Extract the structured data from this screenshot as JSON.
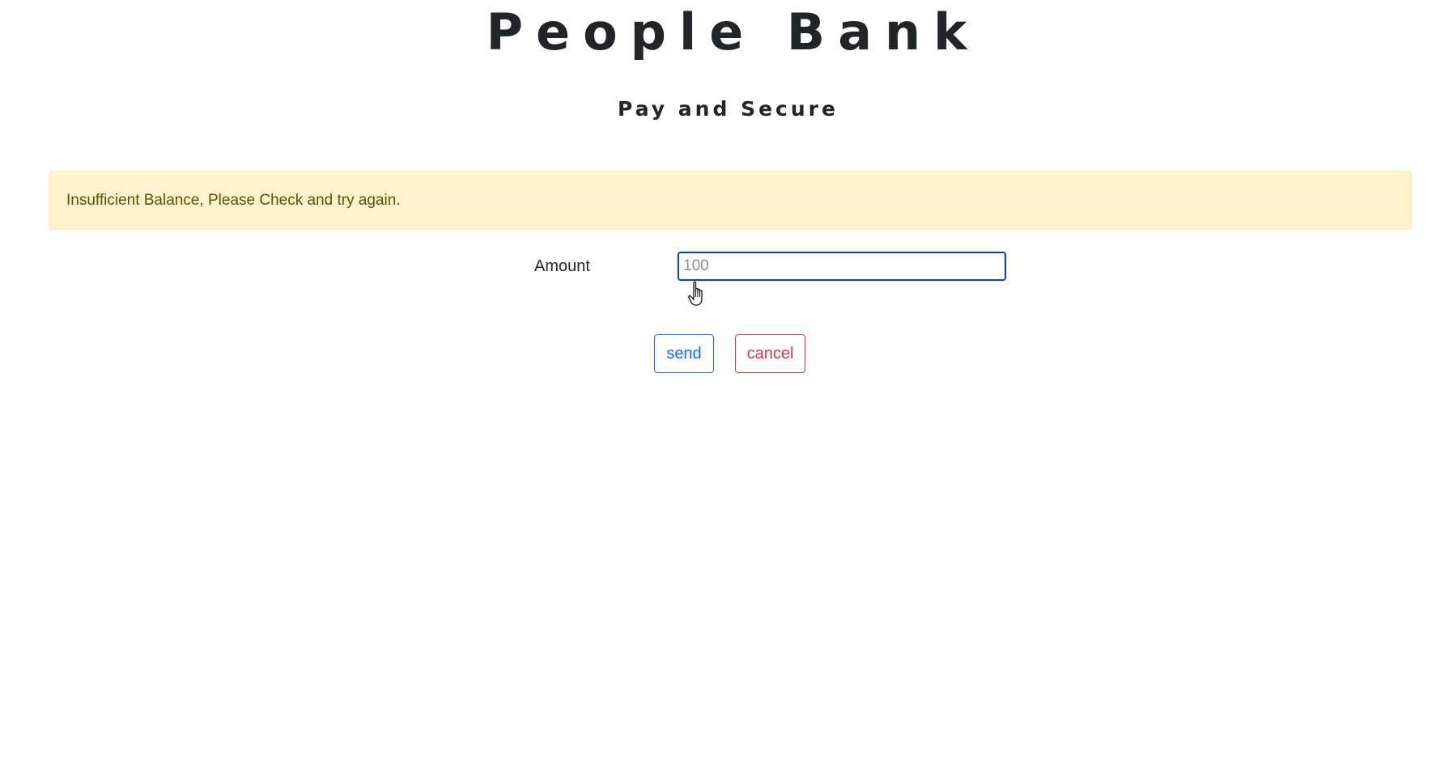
{
  "header": {
    "title": "People Bank",
    "tagline": "Pay and Secure"
  },
  "alert": {
    "message": "Insufficient Balance, Please Check and try again.",
    "background": "#fff3cd",
    "text_color": "#664d03"
  },
  "form": {
    "amount_label": "Amount",
    "amount_placeholder": "100",
    "amount_value": ""
  },
  "actions": {
    "send_label": "send",
    "cancel_label": "cancel"
  },
  "colors": {
    "primary": "#0d6efd",
    "danger": "#dc3545",
    "focus_border": "#0d47c0"
  },
  "icons": {
    "cursor": "hand-pointer-cursor-icon"
  }
}
